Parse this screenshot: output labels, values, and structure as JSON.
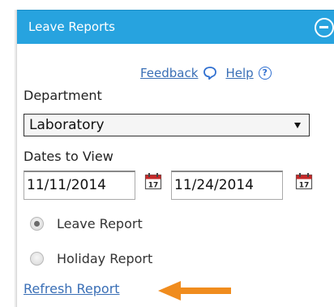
{
  "panel": {
    "title": "Leave Reports"
  },
  "links": {
    "feedback": "Feedback",
    "help": "Help",
    "help_icon_glyph": "?"
  },
  "department": {
    "label": "Department",
    "selected": "Laboratory"
  },
  "dates": {
    "label": "Dates to View",
    "start": "11/11/2014",
    "end": "11/24/2014",
    "calendar_icon_text": "17"
  },
  "report_type": {
    "options": [
      {
        "label": "Leave Report",
        "checked": true
      },
      {
        "label": "Holiday Report",
        "checked": false
      }
    ]
  },
  "actions": {
    "refresh": "Refresh Report"
  },
  "colors": {
    "header_bg": "#27a3df",
    "link": "#3a6fb6",
    "annotation_arrow": "#f08c1e",
    "calendar_red": "#c62828"
  }
}
